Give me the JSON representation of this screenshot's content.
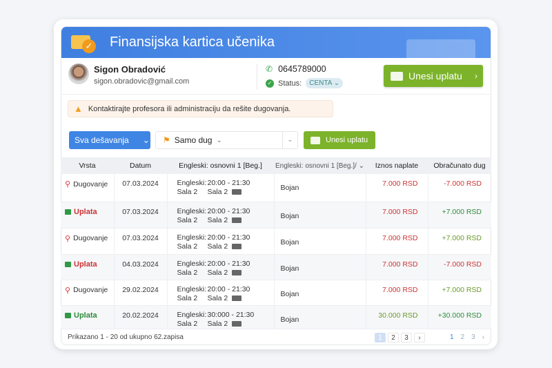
{
  "header": {
    "title": "Finansijska kartica učenika"
  },
  "profile": {
    "name": "Sigon Obradović",
    "email": "sigon.obradovic@gmail.com",
    "phone": "0645789000",
    "status_label": "Status:",
    "status_value": "CENTA",
    "pay_button": "Unesi uplatu"
  },
  "alert": {
    "text": "Kontaktirajte profesora ili administraciju da rešite dugovanja."
  },
  "filters": {
    "events": "Sva dešavanja",
    "debt": "Samo dug",
    "pay_button": "Unesi uplatu"
  },
  "table": {
    "columns": [
      "Vrsta",
      "Datum",
      "Engleski: osnovni 1 [Beg.]",
      "Engleski: osnovni 1 [Beg.]/",
      "Iznos naplate",
      "Obračunato dug"
    ],
    "rows": [
      {
        "type": "Dugovanje",
        "kind": "debt",
        "date": "07.03.2024",
        "course": "Engleski:",
        "time": "20:00 - 21:30",
        "room1": "Sala 2",
        "room2": "Sala 2",
        "teacher": "Bojan",
        "amount": "7.000 RSD",
        "balance": "-7.000 RSD",
        "amount_color": "red",
        "balance_color": "red"
      },
      {
        "type": "Uplata",
        "kind": "payment-red",
        "date": "07.03.2024",
        "course": "Engleski:",
        "time": "20:00 - 21:30",
        "room1": "Sala 2",
        "room2": "Sala 2",
        "teacher": "Bojan",
        "amount": "7.000 RSD",
        "balance": "+7.000 RSD",
        "amount_color": "red",
        "balance_color": "green"
      },
      {
        "type": "Dugovanje",
        "kind": "debt",
        "date": "07.03.2024",
        "course": "Engleski:",
        "time": "20:00 - 21:30",
        "room1": "Sala 2",
        "room2": "Sala 2",
        "teacher": "Bojan",
        "amount": "7.000 RSD",
        "balance": "+7.000 RSD",
        "amount_color": "red",
        "balance_color": "lightgreen"
      },
      {
        "type": "Uplata",
        "kind": "payment-red",
        "date": "04.03.2024",
        "course": "Engleski:",
        "time": "20:00 - 21:30",
        "room1": "Sala 2",
        "room2": "Sala 2",
        "teacher": "Bojan",
        "amount": "7.000 RSD",
        "balance": "-7.000 RSD",
        "amount_color": "red",
        "balance_color": "red"
      },
      {
        "type": "Dugovanje",
        "kind": "debt",
        "date": "29.02.2024",
        "course": "Engleski:",
        "time": "20:00 - 21:30",
        "room1": "Sala 2",
        "room2": "Sala 2",
        "teacher": "Bojan",
        "amount": "7.000 RSD",
        "balance": "+7.000 RSD",
        "amount_color": "red",
        "balance_color": "lightgreen"
      },
      {
        "type": "Uplata",
        "kind": "payment-green",
        "date": "20.02.2024",
        "course": "Engleski:",
        "time": "30:000 - 21:30",
        "room1": "Sala 2",
        "room2": "Sala 2",
        "teacher": "Bojan",
        "amount": "30.000 RSD",
        "balance": "+30.000 RSD",
        "amount_color": "olive",
        "balance_color": "green"
      }
    ]
  },
  "footer": {
    "summary": "Prikazano 1 - 20 od ukupno 62.zapisa",
    "pages": [
      "1",
      "2",
      "3"
    ],
    "next": "›",
    "pages2": [
      "1",
      "2",
      "3"
    ],
    "next2": "›"
  },
  "colors": {
    "header": "#3f7fe0",
    "green_button": "#7cb32a",
    "blue_button": "#3f85e4",
    "red": "#cc3333",
    "green": "#2e8b3a"
  }
}
